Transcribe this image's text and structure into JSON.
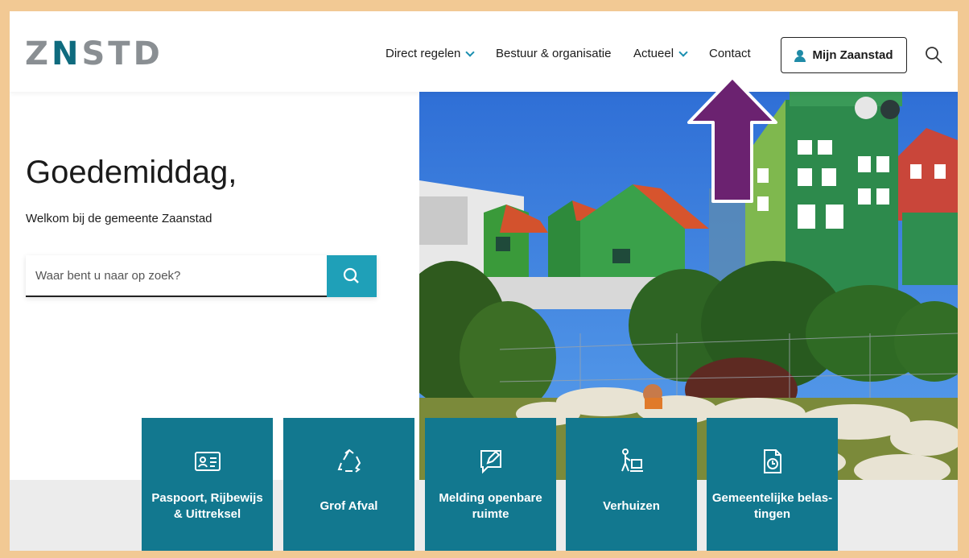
{
  "brand": {
    "logo_text_1": "Z",
    "logo_text_2": "N",
    "logo_text_3": "STD",
    "accent": "#0f6b7e"
  },
  "nav": {
    "items": [
      {
        "label": "Direct regelen",
        "has_dropdown": true
      },
      {
        "label": "Bestuur & organisatie",
        "has_dropdown": false
      },
      {
        "label": "Actueel",
        "has_dropdown": true
      },
      {
        "label": "Contact",
        "has_dropdown": false
      }
    ],
    "account_label": "Mijn Zaanstad",
    "search_icon": "search-icon"
  },
  "hero": {
    "greeting": "Goedemiddag,",
    "welcome": "Welkom bij de gemeente Zaanstad",
    "search_placeholder": "Waar bent u naar op zoek?"
  },
  "tiles": [
    {
      "label": "Paspoort, Rijbewijs & Uittreksel",
      "icon": "id-card-icon"
    },
    {
      "label": "Grof Afval",
      "icon": "recycle-icon"
    },
    {
      "label": "Melding openbare ruimte",
      "icon": "report-message-icon"
    },
    {
      "label": "Verhuizen",
      "icon": "moving-icon"
    },
    {
      "label": "Gemeentelijke belas-tingen",
      "icon": "tax-document-icon"
    }
  ],
  "colors": {
    "tile": "#12788f",
    "search_button": "#1fa0b8",
    "frame": "#f2c994",
    "arrow": "#6b2270"
  }
}
